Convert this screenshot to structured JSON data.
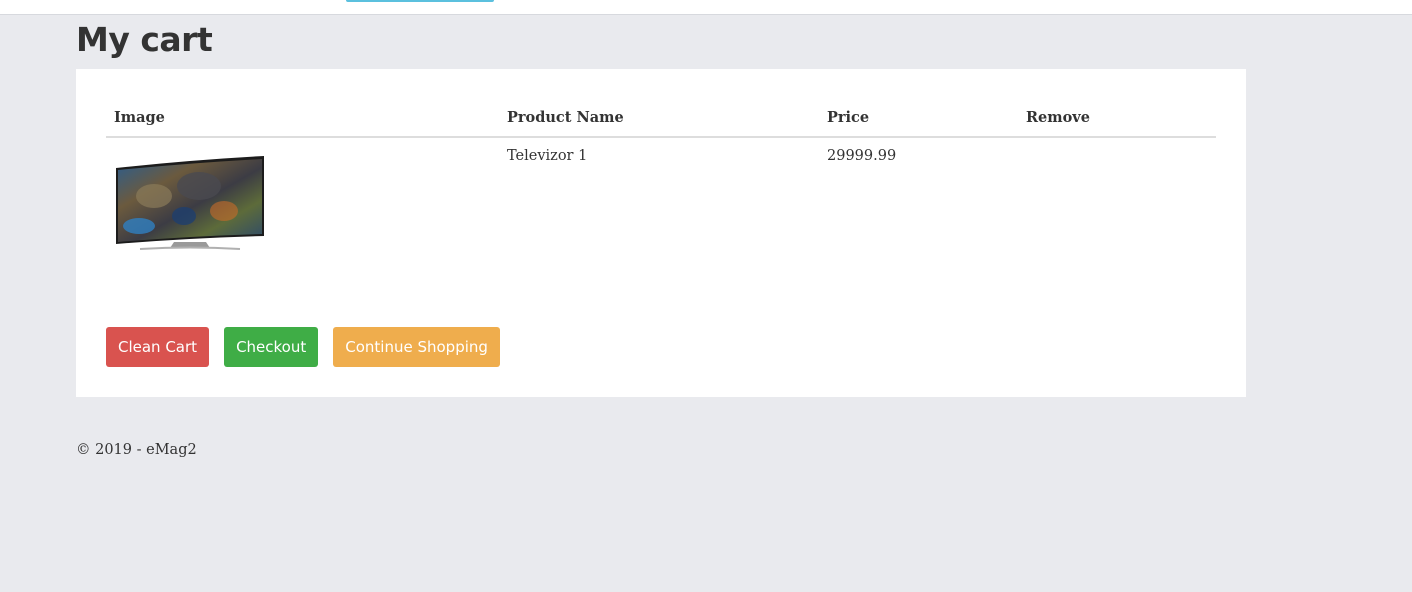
{
  "page": {
    "title": "My cart"
  },
  "table": {
    "headers": {
      "image": "Image",
      "product_name": "Product Name",
      "price": "Price",
      "remove": "Remove"
    },
    "rows": [
      {
        "product_name": "Televizor 1",
        "price": "29999.99",
        "image_icon": "curved-tv-product-image"
      }
    ]
  },
  "actions": {
    "clean_cart": "Clean Cart",
    "checkout": "Checkout",
    "continue_shopping": "Continue Shopping"
  },
  "footer": {
    "copyright": "© 2019 - eMag2"
  },
  "colors": {
    "danger": "#d9534f",
    "success": "#3fad46",
    "warning": "#efad4d",
    "accent": "#5bc0de",
    "background": "#e9eaee"
  }
}
